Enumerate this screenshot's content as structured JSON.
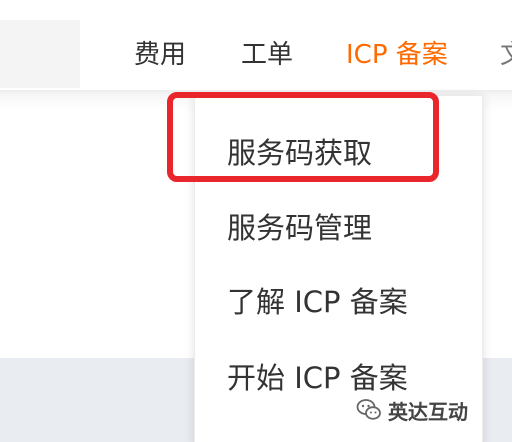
{
  "header": {
    "nav": [
      {
        "label": "费用"
      },
      {
        "label": "工单"
      },
      {
        "label": "ICP 备案"
      }
    ],
    "nav_cut_label": "文",
    "active_color": "#ff6a00"
  },
  "dropdown": {
    "items": [
      {
        "label": "服务码获取"
      },
      {
        "label": "服务码管理"
      },
      {
        "label": "了解 ICP 备案"
      },
      {
        "label": "开始 ICP 备案"
      }
    ]
  },
  "annotation": {
    "highlight_color": "#e8262c"
  },
  "watermark": {
    "text": "英达互动",
    "icon": "wechat-icon"
  }
}
